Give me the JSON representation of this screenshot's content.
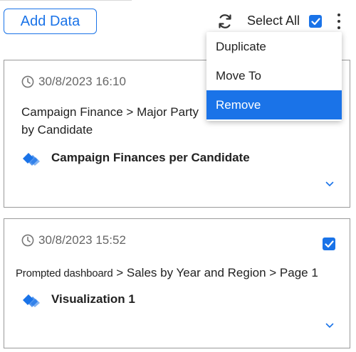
{
  "toolbar": {
    "add_data_label": "Add Data",
    "select_all_label": "Select All",
    "select_all_checked": true
  },
  "menu": {
    "items": [
      {
        "label": "Duplicate",
        "active": false
      },
      {
        "label": "Move To",
        "active": false
      },
      {
        "label": "Remove",
        "active": true
      }
    ]
  },
  "cards": [
    {
      "timestamp": "30/8/2023 16:10",
      "path_line1": "Campaign Finance > Major Party",
      "path_line2": "by Candidate",
      "title": "Campaign Finances per Candidate",
      "checked": false
    },
    {
      "timestamp": "30/8/2023 15:52",
      "path_prefix": "Prompted dashboard",
      "path_rest": " > Sales by Year and Region > Page 1",
      "title": "Visualization 1",
      "checked": true
    }
  ],
  "icons": {
    "refresh": "refresh-icon",
    "kebab": "more-vertical-icon",
    "clock": "clock-icon",
    "visualization": "visualization-icon",
    "expand": "chevron-down-icon",
    "check": "check-icon"
  },
  "colors": {
    "accent": "#1a73e8",
    "border": "#9a9a9a",
    "muted_text": "#666666"
  }
}
